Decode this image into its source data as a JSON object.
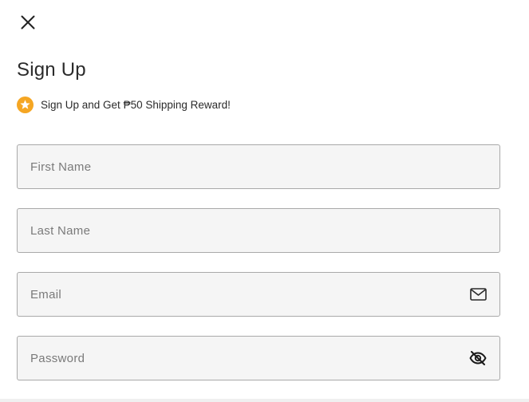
{
  "header": {
    "close_icon": "close-icon",
    "title": "Sign Up"
  },
  "reward": {
    "icon": "star-badge-icon",
    "text": "Sign Up and Get ₱50 Shipping Reward!",
    "icon_color": "#f5a623"
  },
  "form": {
    "first_name": {
      "placeholder": "First Name",
      "value": ""
    },
    "last_name": {
      "placeholder": "Last Name",
      "value": ""
    },
    "email": {
      "placeholder": "Email",
      "value": "",
      "icon": "mail-icon"
    },
    "password": {
      "placeholder": "Password",
      "value": "",
      "icon": "eye-off-icon"
    }
  },
  "colors": {
    "field_background": "#f5f5f5",
    "field_border": "#a9a9a9",
    "text": "#2b2b2b",
    "placeholder": "#7a7a7a"
  }
}
